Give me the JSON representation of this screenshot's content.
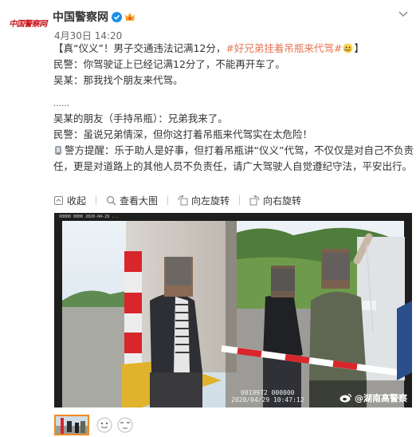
{
  "post": {
    "avatar_text": "中国警察网",
    "author": "中国警察网",
    "time": "4月30日 14:20",
    "lines": [
      {
        "id": "l1",
        "prefix": "【真“仪义”！男子交通违法记满12分，",
        "hashtag": "#好兄弟挂着吊瓶来代驾#",
        "suffix": "】"
      },
      {
        "id": "l2",
        "text": "民警：你驾驶证上已经记满12分了，不能再开车了。"
      },
      {
        "id": "l3",
        "text": "吴某：那我找个朋友来代驾。"
      },
      {
        "id": "l4",
        "text": "……"
      },
      {
        "id": "l5",
        "text": "吴某的朋友（手持吊瓶）：兄弟我来了。"
      },
      {
        "id": "l6",
        "text": "民警：虽说兄弟情深，但你这打着吊瓶来代驾实在太危险！"
      },
      {
        "id": "l7",
        "text": "警方提醒：乐于助人是好事，但打着吊瓶讲“仪义”代驾，不仅仅是对自己不负责任，更是对道路上的其他人员不负责任，请广大驾驶人自觉遵纪守法，平安出行。"
      }
    ]
  },
  "actions": {
    "collapse": "收起",
    "view_large": "查看大图",
    "rotate_left": "向左旋转",
    "rotate_right": "向右旋转"
  },
  "photo": {
    "overlay_top": "X0000 0000 2020-04-29 ...",
    "time_line1": "0019972  000000",
    "time_line2": "2020/04/29 10:47:12",
    "watermark": "湖南高警察",
    "watermark_prefix": "@"
  },
  "icons": {
    "verified": "verified-icon",
    "vip": "vip-icon",
    "more": "chevron-down-icon",
    "collapse": "collapse-icon",
    "view_large": "magnifier-icon",
    "rotate_left": "rotate-left-icon",
    "rotate_right": "rotate-right-icon",
    "alert": "megaphone-icon",
    "emoji": "emoji-icon"
  },
  "colors": {
    "hashtag": "#eb7350",
    "link_orange": "#f08a20",
    "verified_blue": "#1b8ee8",
    "logo_red": "#c8161d"
  }
}
